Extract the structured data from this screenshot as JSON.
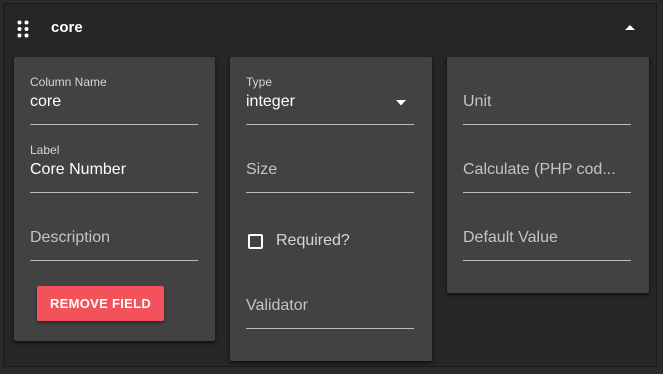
{
  "header": {
    "title": "core",
    "drag_icon": "drag-handle-icon",
    "collapse_icon": "chevron-up-icon"
  },
  "card1": {
    "column_name": {
      "label": "Column Name",
      "value": "core"
    },
    "label_field": {
      "label": "Label",
      "value": "Core Number"
    },
    "description": {
      "placeholder": "Description"
    },
    "remove_button": "REMOVE FIELD"
  },
  "card2": {
    "type": {
      "label": "Type",
      "value": "integer"
    },
    "size": {
      "placeholder": "Size"
    },
    "required": {
      "label": "Required?",
      "checked": false
    },
    "validator": {
      "placeholder": "Validator"
    }
  },
  "card3": {
    "unit": {
      "placeholder": "Unit"
    },
    "calculate": {
      "placeholder": "Calculate (PHP cod..."
    },
    "default_value": {
      "placeholder": "Default Value"
    }
  },
  "colors": {
    "panel_bg": "#262626",
    "card_bg": "#424242",
    "danger": "#f4525a"
  }
}
